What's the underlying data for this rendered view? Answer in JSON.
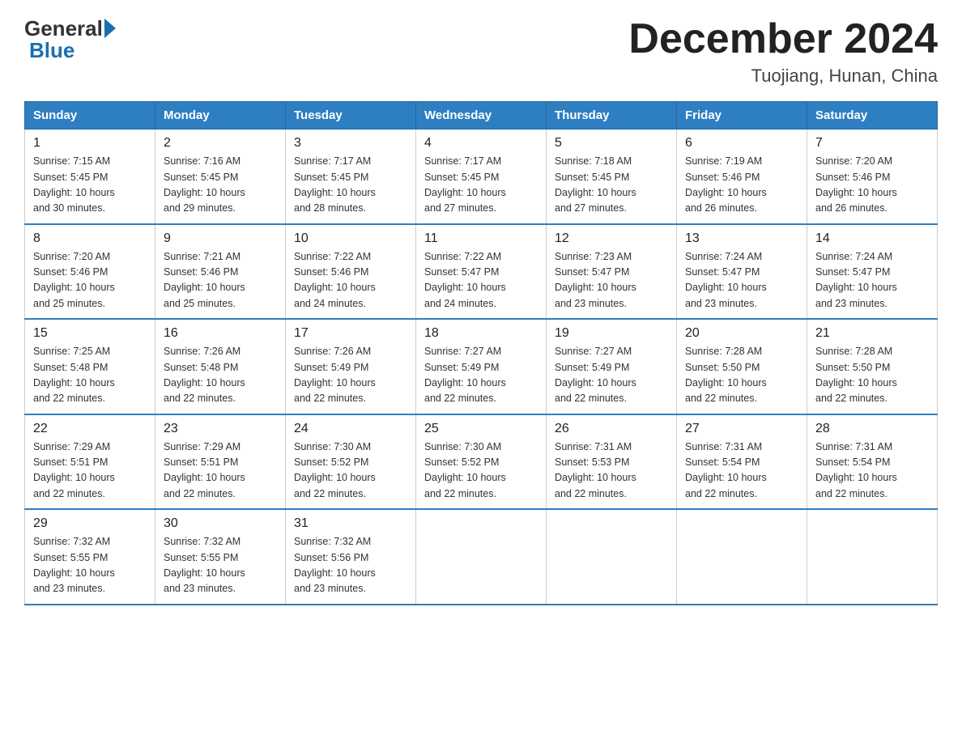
{
  "logo": {
    "general": "General",
    "blue": "Blue"
  },
  "title": "December 2024",
  "location": "Tuojiang, Hunan, China",
  "days_of_week": [
    "Sunday",
    "Monday",
    "Tuesday",
    "Wednesday",
    "Thursday",
    "Friday",
    "Saturday"
  ],
  "weeks": [
    [
      {
        "day": "1",
        "sunrise": "7:15 AM",
        "sunset": "5:45 PM",
        "daylight": "10 hours and 30 minutes."
      },
      {
        "day": "2",
        "sunrise": "7:16 AM",
        "sunset": "5:45 PM",
        "daylight": "10 hours and 29 minutes."
      },
      {
        "day": "3",
        "sunrise": "7:17 AM",
        "sunset": "5:45 PM",
        "daylight": "10 hours and 28 minutes."
      },
      {
        "day": "4",
        "sunrise": "7:17 AM",
        "sunset": "5:45 PM",
        "daylight": "10 hours and 27 minutes."
      },
      {
        "day": "5",
        "sunrise": "7:18 AM",
        "sunset": "5:45 PM",
        "daylight": "10 hours and 27 minutes."
      },
      {
        "day": "6",
        "sunrise": "7:19 AM",
        "sunset": "5:46 PM",
        "daylight": "10 hours and 26 minutes."
      },
      {
        "day": "7",
        "sunrise": "7:20 AM",
        "sunset": "5:46 PM",
        "daylight": "10 hours and 26 minutes."
      }
    ],
    [
      {
        "day": "8",
        "sunrise": "7:20 AM",
        "sunset": "5:46 PM",
        "daylight": "10 hours and 25 minutes."
      },
      {
        "day": "9",
        "sunrise": "7:21 AM",
        "sunset": "5:46 PM",
        "daylight": "10 hours and 25 minutes."
      },
      {
        "day": "10",
        "sunrise": "7:22 AM",
        "sunset": "5:46 PM",
        "daylight": "10 hours and 24 minutes."
      },
      {
        "day": "11",
        "sunrise": "7:22 AM",
        "sunset": "5:47 PM",
        "daylight": "10 hours and 24 minutes."
      },
      {
        "day": "12",
        "sunrise": "7:23 AM",
        "sunset": "5:47 PM",
        "daylight": "10 hours and 23 minutes."
      },
      {
        "day": "13",
        "sunrise": "7:24 AM",
        "sunset": "5:47 PM",
        "daylight": "10 hours and 23 minutes."
      },
      {
        "day": "14",
        "sunrise": "7:24 AM",
        "sunset": "5:47 PM",
        "daylight": "10 hours and 23 minutes."
      }
    ],
    [
      {
        "day": "15",
        "sunrise": "7:25 AM",
        "sunset": "5:48 PM",
        "daylight": "10 hours and 22 minutes."
      },
      {
        "day": "16",
        "sunrise": "7:26 AM",
        "sunset": "5:48 PM",
        "daylight": "10 hours and 22 minutes."
      },
      {
        "day": "17",
        "sunrise": "7:26 AM",
        "sunset": "5:49 PM",
        "daylight": "10 hours and 22 minutes."
      },
      {
        "day": "18",
        "sunrise": "7:27 AM",
        "sunset": "5:49 PM",
        "daylight": "10 hours and 22 minutes."
      },
      {
        "day": "19",
        "sunrise": "7:27 AM",
        "sunset": "5:49 PM",
        "daylight": "10 hours and 22 minutes."
      },
      {
        "day": "20",
        "sunrise": "7:28 AM",
        "sunset": "5:50 PM",
        "daylight": "10 hours and 22 minutes."
      },
      {
        "day": "21",
        "sunrise": "7:28 AM",
        "sunset": "5:50 PM",
        "daylight": "10 hours and 22 minutes."
      }
    ],
    [
      {
        "day": "22",
        "sunrise": "7:29 AM",
        "sunset": "5:51 PM",
        "daylight": "10 hours and 22 minutes."
      },
      {
        "day": "23",
        "sunrise": "7:29 AM",
        "sunset": "5:51 PM",
        "daylight": "10 hours and 22 minutes."
      },
      {
        "day": "24",
        "sunrise": "7:30 AM",
        "sunset": "5:52 PM",
        "daylight": "10 hours and 22 minutes."
      },
      {
        "day": "25",
        "sunrise": "7:30 AM",
        "sunset": "5:52 PM",
        "daylight": "10 hours and 22 minutes."
      },
      {
        "day": "26",
        "sunrise": "7:31 AM",
        "sunset": "5:53 PM",
        "daylight": "10 hours and 22 minutes."
      },
      {
        "day": "27",
        "sunrise": "7:31 AM",
        "sunset": "5:54 PM",
        "daylight": "10 hours and 22 minutes."
      },
      {
        "day": "28",
        "sunrise": "7:31 AM",
        "sunset": "5:54 PM",
        "daylight": "10 hours and 22 minutes."
      }
    ],
    [
      {
        "day": "29",
        "sunrise": "7:32 AM",
        "sunset": "5:55 PM",
        "daylight": "10 hours and 23 minutes."
      },
      {
        "day": "30",
        "sunrise": "7:32 AM",
        "sunset": "5:55 PM",
        "daylight": "10 hours and 23 minutes."
      },
      {
        "day": "31",
        "sunrise": "7:32 AM",
        "sunset": "5:56 PM",
        "daylight": "10 hours and 23 minutes."
      },
      null,
      null,
      null,
      null
    ]
  ],
  "labels": {
    "sunrise": "Sunrise:",
    "sunset": "Sunset:",
    "daylight": "Daylight:"
  }
}
